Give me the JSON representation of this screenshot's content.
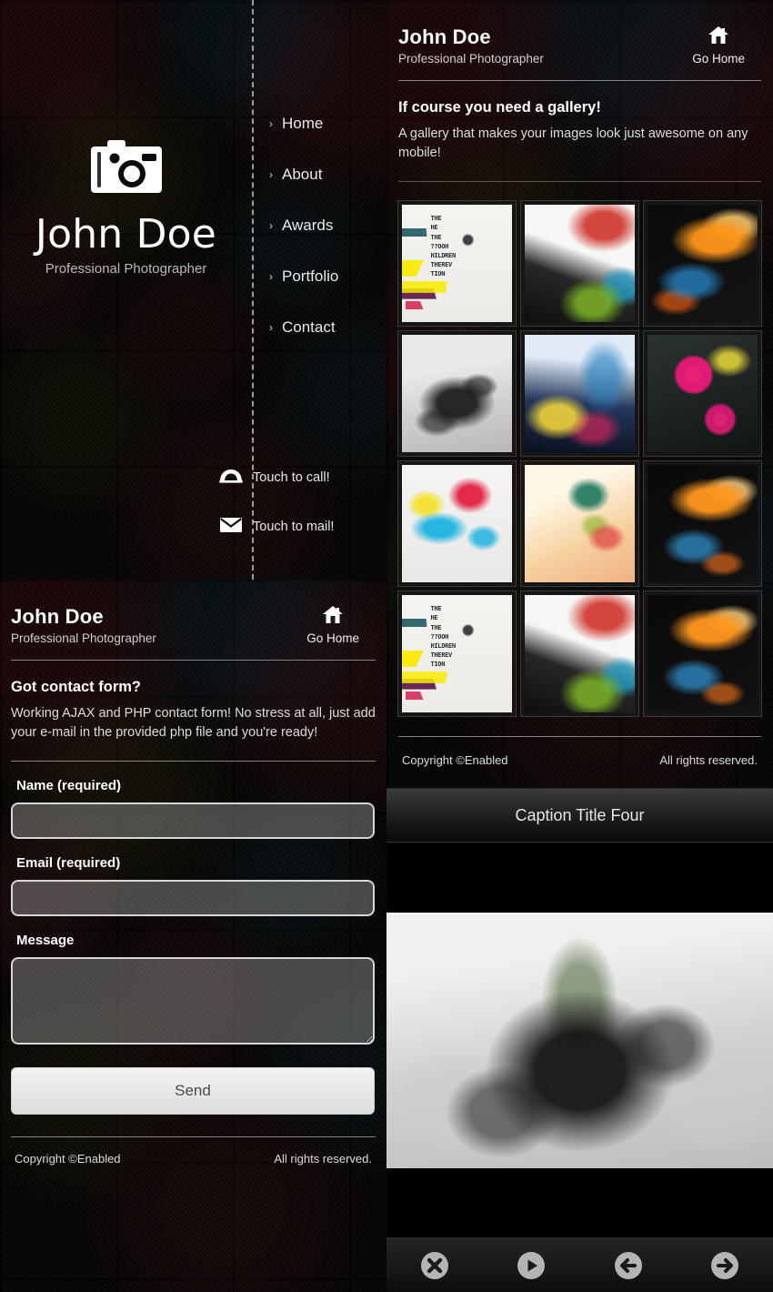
{
  "brand": {
    "name": "John Doe",
    "role": "Professional Photographer",
    "logo_icon": "camera-icon"
  },
  "nav": {
    "chevron": "›",
    "items": [
      {
        "label": "Home"
      },
      {
        "label": "About"
      },
      {
        "label": "Awards"
      },
      {
        "label": "Portfolio"
      },
      {
        "label": "Contact"
      }
    ]
  },
  "touch_actions": [
    {
      "icon": "phone-icon",
      "label": "Touch to call!"
    },
    {
      "icon": "mail-icon",
      "label": "Touch to mail!"
    }
  ],
  "contact_panel": {
    "header": {
      "name": "John Doe",
      "role": "Professional Photographer",
      "home_icon": "home-icon",
      "home_label": "Go Home"
    },
    "section_title": "Got contact form?",
    "section_body": "Working AJAX and PHP contact form! No stress at all, just add your e-mail in the provided php file and you're ready!",
    "fields": [
      {
        "label": "Name (required)",
        "value": "",
        "placeholder": ""
      },
      {
        "label": "Email (required)",
        "value": "",
        "placeholder": ""
      },
      {
        "label": "Message",
        "value": "",
        "placeholder": ""
      }
    ],
    "submit_label": "Send",
    "footer": {
      "copyright": "Copyright ©Enabled",
      "rights": "All rights reserved."
    }
  },
  "gallery_panel": {
    "header": {
      "name": "John Doe",
      "role": "Professional Photographer",
      "home_icon": "home-icon",
      "home_label": "Go Home"
    },
    "section_title": "If course you need a gallery!",
    "section_body": "A gallery that makes your images look just awesome on any mobile!",
    "thumbnails": [
      {
        "art": "art-graffiti",
        "alt": "graffiti-typography-artwork"
      },
      {
        "art": "art-swirl-white",
        "alt": "white-swirl-abstract"
      },
      {
        "art": "art-fire",
        "alt": "orange-flame-abstract"
      },
      {
        "art": "art-ruin",
        "alt": "grayscale-ruins-artwork"
      },
      {
        "art": "art-blue-flow",
        "alt": "blue-flow-abstract"
      },
      {
        "art": "art-magenta",
        "alt": "magenta-circle-abstract"
      },
      {
        "art": "art-splash",
        "alt": "colour-splash-artwork"
      },
      {
        "art": "art-warm",
        "alt": "warm-gradient-artwork"
      },
      {
        "art": "art-copper",
        "alt": "copper-flame-abstract"
      },
      {
        "art": "art-graffiti",
        "alt": "graffiti-typography-artwork"
      },
      {
        "art": "art-swirl-white",
        "alt": "white-swirl-abstract"
      },
      {
        "art": "art-copper",
        "alt": "copper-flame-abstract"
      }
    ],
    "footer": {
      "copyright": "Copyright ©Enabled",
      "rights": "All rights reserved."
    }
  },
  "lightbox": {
    "caption": "Caption Title Four",
    "image_alt": "grayscale-ruins-artwork",
    "controls": [
      {
        "icon": "close-icon",
        "name": "close-button"
      },
      {
        "icon": "play-icon",
        "name": "play-button"
      },
      {
        "icon": "arrow-left-icon",
        "name": "previous-button"
      },
      {
        "icon": "arrow-right-icon",
        "name": "next-button"
      }
    ]
  },
  "colors": {
    "background": "#0d0b0a",
    "text_primary": "#ffffff",
    "text_secondary": "#cfcfcf",
    "button_face": "#e9e9e9"
  }
}
